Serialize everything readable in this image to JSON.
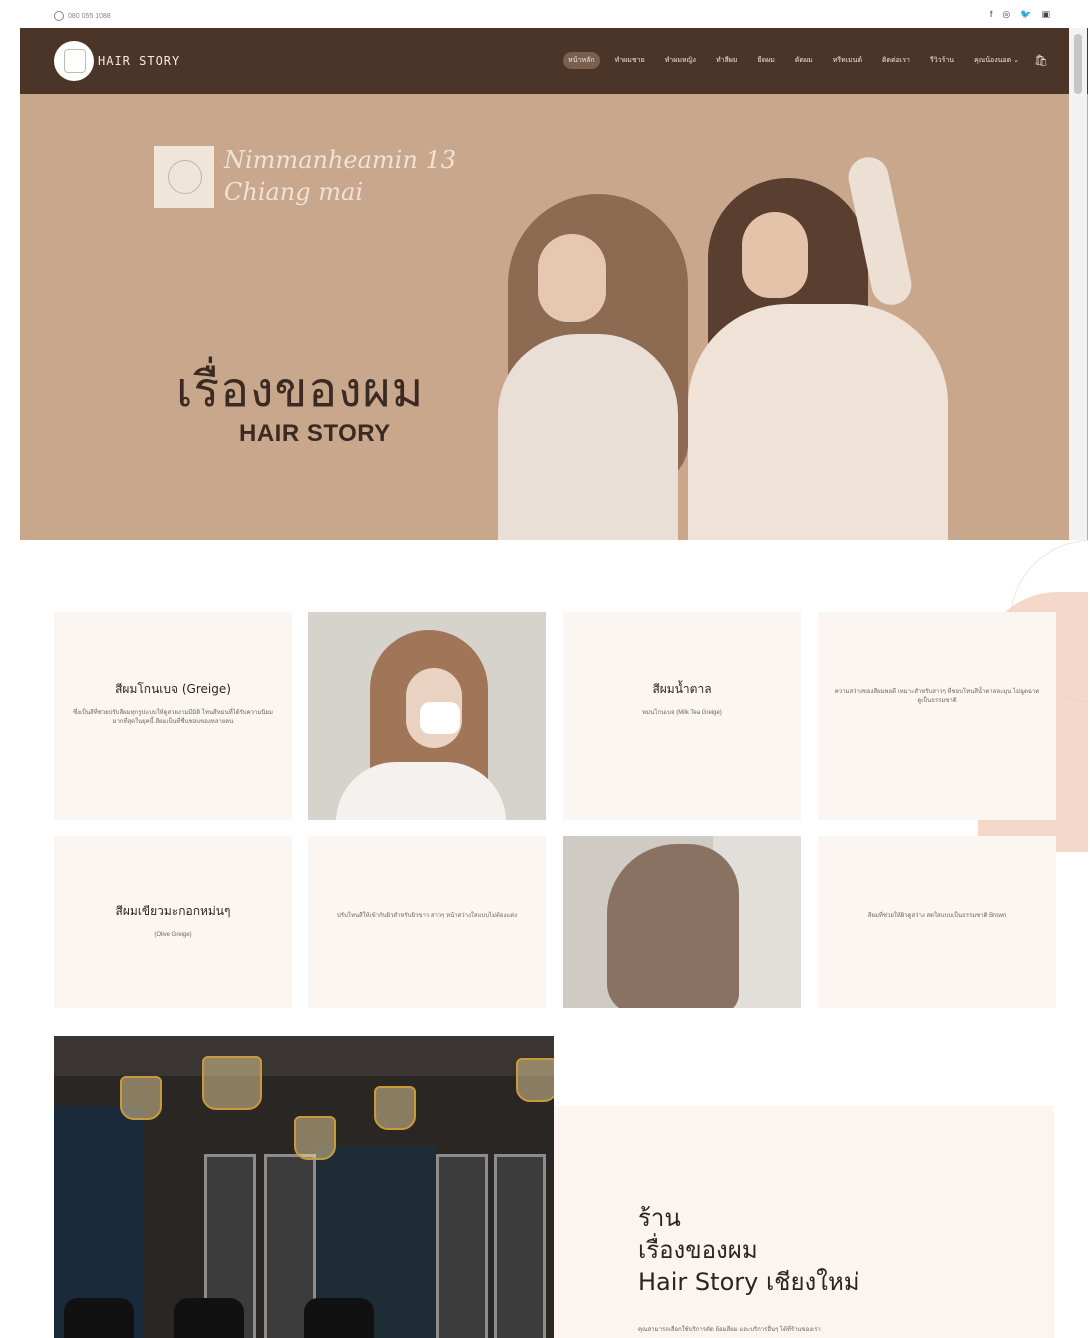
{
  "topbar": {
    "phone": "080 055 1088",
    "social": [
      "f",
      "◎",
      "🐦",
      "▣"
    ]
  },
  "header": {
    "logo_text": "HAIR STORY",
    "nav": [
      {
        "label": "หน้าหลัก",
        "active": true
      },
      {
        "label": "ทำผมชาย"
      },
      {
        "label": "ทำผมหญิง"
      },
      {
        "label": "ทำสีผม"
      },
      {
        "label": "ยืดผม"
      },
      {
        "label": "ดัดผม"
      },
      {
        "label": "ทรีทเมนต์"
      },
      {
        "label": "ติดต่อเรา"
      },
      {
        "label": "รีวิวร้าน"
      },
      {
        "label": "คุณน้องนอต"
      }
    ]
  },
  "hero": {
    "script_line1": "Nimmanheamin 13",
    "script_line2": "Chiang mai",
    "title_th": "เรื่องของผม",
    "title_en": "HAIR STORY"
  },
  "grid": {
    "card1": {
      "title": "สีผมโกนเบจ (Greige)",
      "text": "ซึ่งเป็นสีที่ช่วยปรับสีผมทุกรูปแบบให้ดูสวยงามมีมิติ โทนสีหม่นที่ได้รับความนิยมมากที่สุดในยุคนี้ สีผมเป็นที่ชื่นชอบของหลายคน"
    },
    "card2": {
      "title": "สีผมน้ำตาล",
      "text": "หม่นโกนเบจ (Milk Tea Greige)"
    },
    "card3": {
      "text": "ความสว่างของสีผมพอดี เหมาะสำหรับสาวๆ ที่ชอบโทนสีน้ำตาลละมุน ไม่ฉูดฉาด ดูเป็นธรรมชาติ"
    },
    "card4": {
      "title": "สีผมเขียวมะกอกหม่นๆ",
      "text": "(Olive Greige)"
    },
    "card5": {
      "text": "ปรับโทนสีให้เข้ากับผิวสำหรับผิวขาว สาวๆ หน้าสว่างใสแบบไม่ต้องแต่ง"
    },
    "card6": {
      "text": "สีผมที่ช่วยให้ผิวดูสว่าง สดใสแบบเป็นธรรมชาติ Brown"
    }
  },
  "about": {
    "line1": "ร้าน",
    "line2": "เรื่องของผม",
    "line3": "Hair Story เชียงใหม่",
    "desc": "คุณสามารถเลือกใช้บริการตัด ย้อมสีผม และบริการอื่นๆ ได้ที่ร้านของเรา"
  }
}
